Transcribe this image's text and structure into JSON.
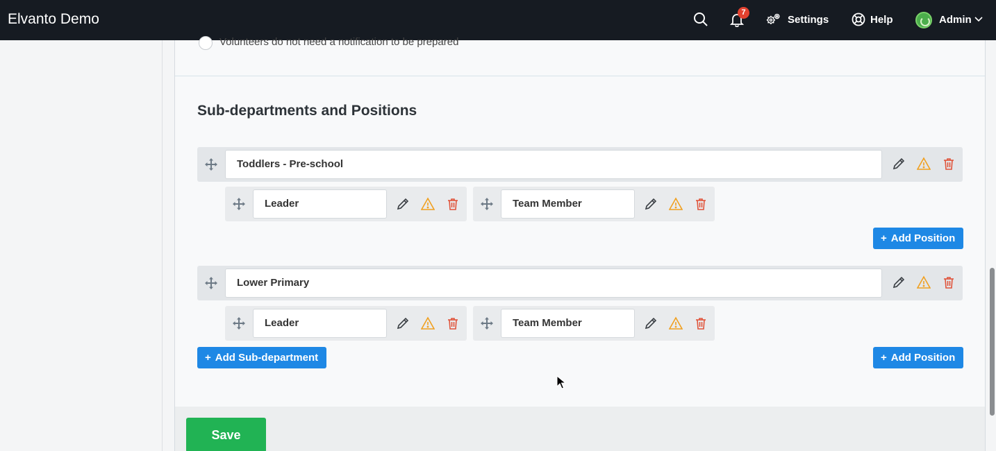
{
  "topbar": {
    "brand": "Elvanto Demo",
    "notification_count": "7",
    "settings_label": "Settings",
    "help_label": "Help",
    "user_label": "Admin"
  },
  "volunteer_option": {
    "label": "Volunteers do not need a notification to be prepared"
  },
  "section": {
    "title": "Sub-departments and Positions",
    "departments": [
      {
        "name": "Toddlers - Pre-school",
        "positions": [
          {
            "name": "Leader"
          },
          {
            "name": "Team Member"
          }
        ]
      },
      {
        "name": "Lower Primary",
        "positions": [
          {
            "name": "Leader"
          },
          {
            "name": "Team Member"
          }
        ]
      }
    ],
    "add_position_label": "Add Position",
    "add_subdepartment_label": "Add Sub-department"
  },
  "footer": {
    "save_label": "Save"
  },
  "colors": {
    "topbar": "#161b22",
    "primary": "#1e88e5",
    "success": "#21b354",
    "warning": "#f0a020",
    "danger": "#e0533a",
    "badge": "#e2412f"
  },
  "icons": {
    "search": "search-icon",
    "bell": "bell-icon",
    "settings": "gears-icon",
    "help": "lifebuoy-icon",
    "drag": "move-icon",
    "edit": "pencil-icon",
    "warning": "warning-icon",
    "delete": "trash-icon"
  }
}
